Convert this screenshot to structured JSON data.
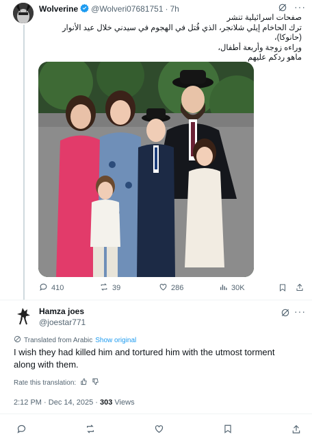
{
  "tweet1": {
    "display_name": "Wolverine",
    "handle": "@Wolveri07681751",
    "separator": "·",
    "time": "7h",
    "text_lines": [
      "صفحات اسرائيلية تنشر",
      "ترك الحاخام إيلي شلانجر، الذي قُتل في الهجوم  في سيدني خلال عيد الأنوار (حانوكا)،",
      "وراءه زوجة وأربعة أطفال،",
      "ماهو ردكم عليهم"
    ],
    "stats": {
      "replies": "410",
      "reposts": "39",
      "likes": "286",
      "views": "30K"
    }
  },
  "tweet2": {
    "display_name": "Hamza joes",
    "handle": "@joestar771",
    "translated_label": "Translated from Arabic",
    "show_original": "Show original",
    "text": "I wish they had killed him and tortured him with the utmost torment along with them.",
    "rate_label": "Rate this translation:",
    "time": "2:12 PM",
    "date": "Dec 14, 2025",
    "views_count": "303",
    "views_label": "Views"
  },
  "icons": [
    "grok-icon",
    "more-icon",
    "verified-badge-icon",
    "reply-icon",
    "repost-icon",
    "like-icon",
    "views-icon",
    "bookmark-icon",
    "share-icon",
    "translate-icon",
    "thumbs-up-icon",
    "thumbs-down-icon"
  ],
  "colors": {
    "link": "#1d9bf0",
    "verified": "#1d9bf0",
    "muted": "#536471",
    "text": "#0f1419"
  }
}
